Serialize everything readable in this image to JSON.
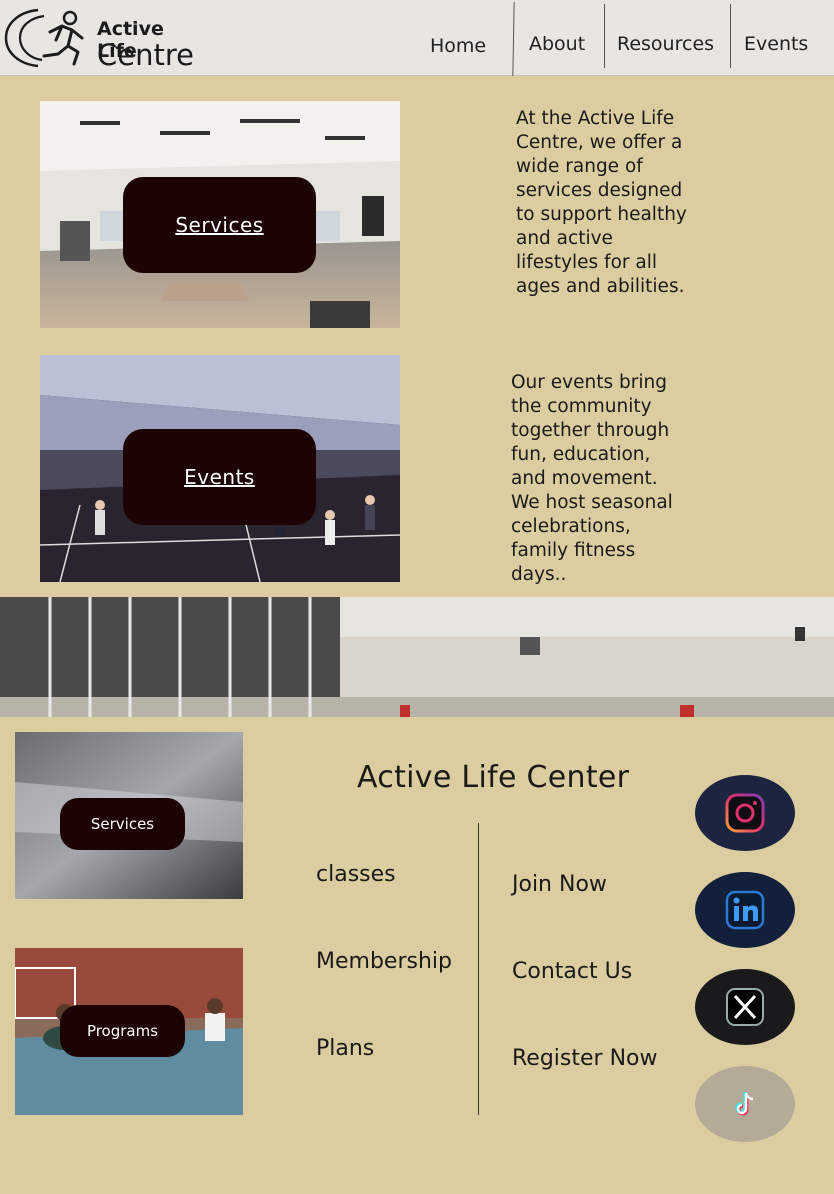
{
  "header": {
    "logo_line1": "Active Life",
    "logo_line2": "Centre",
    "nav": [
      "Home",
      "About",
      "Resources",
      "Events"
    ]
  },
  "hero": [
    {
      "button_label": "Services",
      "text": "At the Active Life Centre, we offer a wide range of services designed to support healthy and active lifestyles for all ages and abilities."
    },
    {
      "button_label": "Events",
      "text": "Our events bring the community together through fun, education, and movement. We host seasonal celebrations, family fitness days.."
    }
  ],
  "footer": {
    "title": "Active Life Center",
    "cards": [
      "Services",
      "Programs"
    ],
    "links_left": [
      "classes",
      "Membership",
      "Plans"
    ],
    "links_right": [
      "Join Now",
      "Contact Us",
      "Register Now"
    ],
    "social": [
      "instagram-icon",
      "linkedin-icon",
      "x-icon",
      "tiktok-icon"
    ]
  },
  "colors": {
    "background": "#dbcda0",
    "header": "#e8e6e0",
    "button": "#1c0404"
  }
}
